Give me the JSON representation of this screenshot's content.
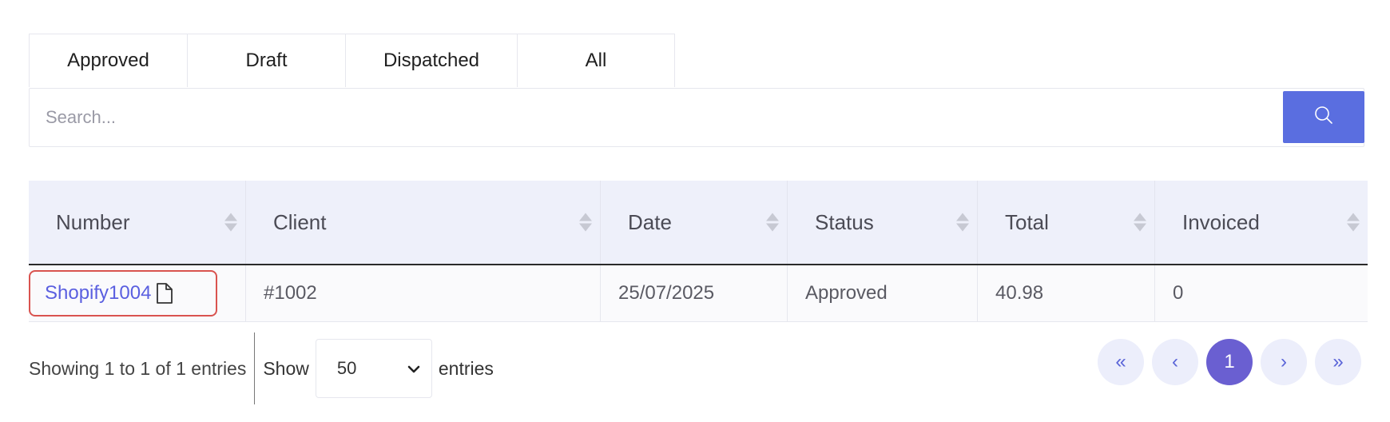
{
  "tabs": [
    {
      "label": "Approved"
    },
    {
      "label": "Draft"
    },
    {
      "label": "Dispatched"
    },
    {
      "label": "All"
    }
  ],
  "search": {
    "placeholder": "Search...",
    "button_icon": "search-icon",
    "button_color": "#5a6ee0"
  },
  "table": {
    "columns": [
      "Number",
      "Client",
      "Date",
      "Status",
      "Total",
      "Invoiced"
    ],
    "rows": [
      {
        "number": "Shopify1004",
        "client": "#1002",
        "date": "25/07/2025",
        "status": "Approved",
        "total": "40.98",
        "invoiced": "0"
      }
    ]
  },
  "footer": {
    "showing": "Showing 1 to 1 of 1 entries",
    "show_label": "Show",
    "page_size": "50",
    "entries_label": "entries"
  },
  "pagination": {
    "first": "«",
    "prev": "‹",
    "current": "1",
    "next": "›",
    "last": "»",
    "active_color": "#6a5fd1"
  },
  "colors": {
    "link": "#5a5fe0",
    "highlight_border": "#d9534f",
    "header_bg": "#eef0fa"
  }
}
